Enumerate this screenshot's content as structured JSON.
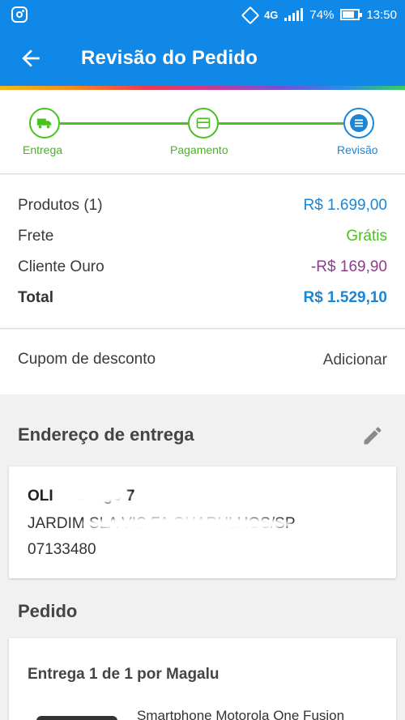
{
  "status_bar": {
    "network": "4G",
    "battery": "74%",
    "time": "13:50"
  },
  "header": {
    "title": "Revisão do Pedido"
  },
  "steps": [
    {
      "label": "Entrega",
      "icon": "truck-icon"
    },
    {
      "label": "Pagamento",
      "icon": "card-icon"
    },
    {
      "label": "Revisão",
      "icon": "list-icon"
    }
  ],
  "summary": {
    "products_label": "Produtos (1)",
    "products_value": "R$ 1.699,00",
    "shipping_label": "Frete",
    "shipping_value": "Grátis",
    "gold_label": "Cliente Ouro",
    "gold_value": "-R$ 169,90",
    "total_label": "Total",
    "total_value": "R$ 1.529,10"
  },
  "coupon": {
    "label": "Cupom de desconto",
    "action": "Adicionar"
  },
  "address": {
    "title": "Endereço de entrega",
    "line1": "OLI        - antigo 7",
    "line2": "JARDIM      SLA VIS    FA    GUARULHOS/SP",
    "line3": "07133480"
  },
  "order": {
    "title": "Pedido",
    "delivery": "Entrega 1 de 1 por Magalu",
    "product_name": "Smartphone Motorola One Fusion"
  },
  "colors": {
    "brand_blue": "#1088e8",
    "green": "#48c31e",
    "price_blue": "#1b86d6",
    "gold_purple": "#8e3b8a"
  }
}
